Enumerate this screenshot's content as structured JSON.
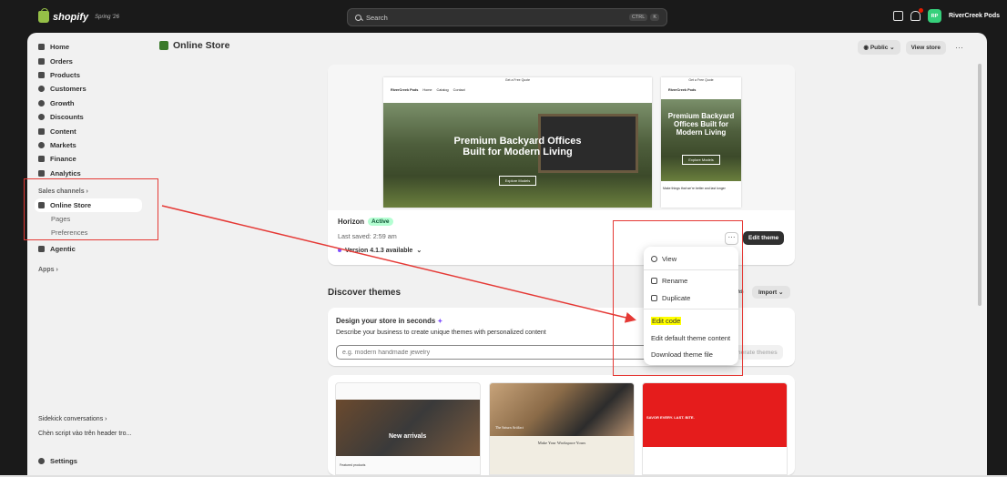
{
  "topbar": {
    "logo": "shopify",
    "logo_sub": "Spring '26",
    "search_placeholder": "Search",
    "kbd": [
      "CTRL",
      "K"
    ],
    "avatar_initials": "RP",
    "store_name": "RiverCreek Pods"
  },
  "sidebar": {
    "items": [
      {
        "label": "Home",
        "icon": "home-icon"
      },
      {
        "label": "Orders",
        "icon": "orders-icon"
      },
      {
        "label": "Products",
        "icon": "tag-icon"
      },
      {
        "label": "Customers",
        "icon": "person-icon"
      },
      {
        "label": "Growth",
        "icon": "growth-icon"
      },
      {
        "label": "Discounts",
        "icon": "discount-icon"
      },
      {
        "label": "Content",
        "icon": "content-icon"
      },
      {
        "label": "Markets",
        "icon": "globe-icon"
      },
      {
        "label": "Finance",
        "icon": "bank-icon"
      },
      {
        "label": "Analytics",
        "icon": "chart-icon"
      }
    ],
    "sales_channels": "Sales channels",
    "online_store": "Online Store",
    "sub_items": [
      "Pages",
      "Preferences"
    ],
    "agentic": "Agentic",
    "apps": "Apps",
    "sidekick": "Sidekick conversations",
    "sidekick_item": "Chèn script vào trên header tro...",
    "settings": "Settings"
  },
  "header": {
    "title": "Online Store",
    "public_label": "Public",
    "view_store": "View store",
    "more": "···"
  },
  "theme": {
    "name": "Horizon",
    "status": "Active",
    "last_saved": "Last saved: 2:59 am",
    "version": "Version 4.1.3 available",
    "edit_theme": "Edit theme",
    "more": "···",
    "preview": {
      "announcement": "Get a Free Quote",
      "brand": "RiverCreek Pods",
      "nav": [
        "Home",
        "Catalog",
        "Contact"
      ],
      "hero_line1": "Premium Backyard Offices",
      "hero_line2": "Built for Modern Living",
      "cta": "Explore Models",
      "mobile_hero_line1": "Premium Backyard",
      "mobile_hero_line2": "Offices Built for",
      "mobile_hero_line3": "Modern Living",
      "mobile_strip": "Make things that we're better and last longer"
    }
  },
  "discover": {
    "title": "Discover themes",
    "explore_partial": "ons",
    "import": "Import",
    "design_title": "Design your store in seconds",
    "design_desc": "Describe your business to create unique themes with personalized content",
    "input_placeholder": "e.g. modern handmade jewelry",
    "generate": "Generate themes",
    "thumbs": [
      {
        "caption": "New arrivals",
        "sub": "Featured products"
      },
      {
        "caption": "Make Your Workspace Yours",
        "sub": "The Saturn Artifact"
      },
      {
        "caption": "SAVOR EVERY. LAST. BITE."
      }
    ]
  },
  "popover": {
    "items": [
      "View",
      "Rename",
      "Duplicate",
      "Edit code",
      "Edit default theme content",
      "Download theme file"
    ]
  },
  "colors": {
    "annotation": "#e53935",
    "highlight": "#ffff00",
    "active_badge_bg": "#b4fed2"
  }
}
